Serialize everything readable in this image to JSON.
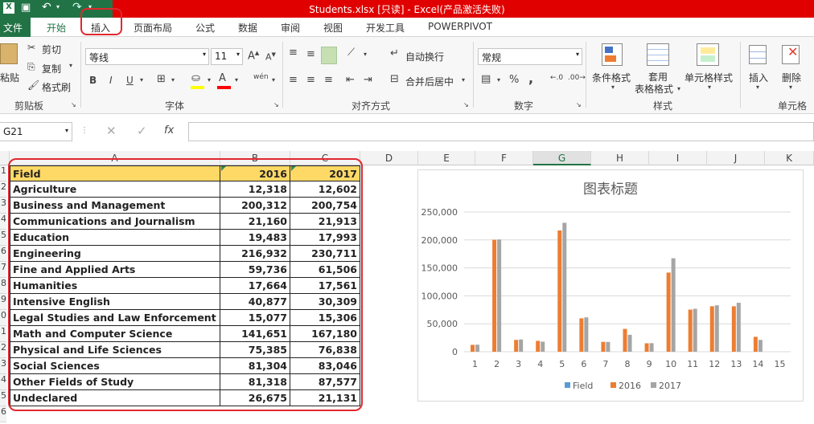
{
  "window": {
    "title": "Students.xlsx  [只读] - Excel(产品激活失败)"
  },
  "tabs": [
    "文件",
    "开始",
    "插入",
    "页面布局",
    "公式",
    "数据",
    "审阅",
    "视图",
    "开发工具",
    "POWERPIVOT"
  ],
  "ribbon": {
    "clipboard": {
      "paste": "粘贴",
      "cut": "剪切",
      "copy": "复制",
      "format_painter": "格式刷",
      "group": "剪贴板"
    },
    "font": {
      "name": "等线",
      "size": "11",
      "group": "字体",
      "bold": "B",
      "italic": "I",
      "underline": "U",
      "wen": "wén"
    },
    "alignment": {
      "wrap": "自动换行",
      "merge": "合并后居中",
      "group": "对齐方式"
    },
    "number": {
      "format": "常规",
      "group": "数字",
      "percent": "%",
      "comma": ","
    },
    "styles": {
      "conditional": "条件格式",
      "table1": "套用",
      "table2": "表格格式",
      "cell_styles": "单元格样式",
      "group": "样式"
    },
    "cells": {
      "insert": "插入",
      "delete": "删除",
      "group": "单元格"
    }
  },
  "formula_bar": {
    "name_box": "G21",
    "formula": ""
  },
  "columns": [
    "A",
    "B",
    "C",
    "D",
    "E",
    "F",
    "G",
    "H",
    "I",
    "J",
    "K"
  ],
  "row_numbers": [
    "1",
    "2",
    "3",
    "4",
    "5",
    "6",
    "7",
    "8",
    "9",
    "0",
    "1",
    "2",
    "3",
    "4",
    "5",
    "6"
  ],
  "table": {
    "header": [
      "Field",
      "2016",
      "2017"
    ],
    "rows": [
      [
        "Agriculture",
        "12,318",
        "12,602"
      ],
      [
        "Business and Management",
        "200,312",
        "200,754"
      ],
      [
        "Communications and Journalism",
        "21,160",
        "21,913"
      ],
      [
        "Education",
        "19,483",
        "17,993"
      ],
      [
        "Engineering",
        "216,932",
        "230,711"
      ],
      [
        "Fine and Applied Arts",
        "59,736",
        "61,506"
      ],
      [
        "Humanities",
        "17,664",
        "17,561"
      ],
      [
        "Intensive English",
        "40,877",
        "30,309"
      ],
      [
        "Legal Studies and Law Enforcement",
        "15,077",
        "15,306"
      ],
      [
        "Math and Computer Science",
        "141,651",
        "167,180"
      ],
      [
        "Physical and Life Sciences",
        "75,385",
        "76,838"
      ],
      [
        "Social Sciences",
        "81,304",
        "83,046"
      ],
      [
        "Other Fields of Study",
        "81,318",
        "87,577"
      ],
      [
        "Undeclared",
        "26,675",
        "21,131"
      ]
    ]
  },
  "chart_data": {
    "type": "bar",
    "title": "图表标题",
    "categories": [
      "1",
      "2",
      "3",
      "4",
      "5",
      "6",
      "7",
      "8",
      "9",
      "10",
      "11",
      "12",
      "13",
      "14",
      "15"
    ],
    "ylim": [
      0,
      250000
    ],
    "yticks": [
      "0",
      "50,000",
      "100,000",
      "150,000",
      "200,000",
      "250,000"
    ],
    "series": [
      {
        "name": "Field",
        "values": []
      },
      {
        "name": "2016",
        "values": [
          12318,
          200312,
          21160,
          19483,
          216932,
          59736,
          17664,
          40877,
          15077,
          141651,
          75385,
          81304,
          81318,
          26675
        ]
      },
      {
        "name": "2017",
        "values": [
          12602,
          200754,
          21913,
          17993,
          230711,
          61506,
          17561,
          30309,
          15306,
          167180,
          76838,
          83046,
          87577,
          21131
        ]
      }
    ],
    "colors": {
      "Field": "#5b9bd5",
      "2016": "#ed7d31",
      "2017": "#a5a5a5"
    },
    "legend_position": "bottom"
  }
}
